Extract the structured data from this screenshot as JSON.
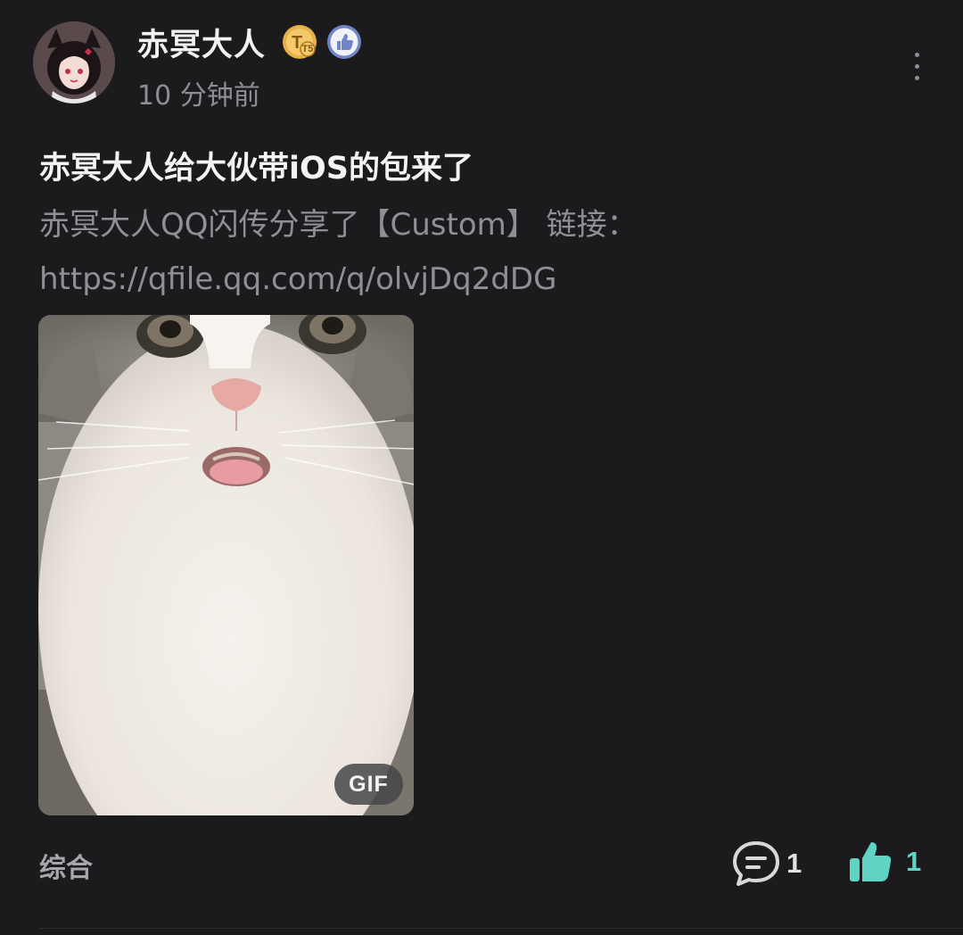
{
  "author": {
    "name": "赤冥大人",
    "level_badge": "T5",
    "level_icon": "level-t5-badge-icon",
    "like_badge_icon": "thumbs-up-badge-icon",
    "time": "10 分钟前"
  },
  "post": {
    "title": "赤冥大人给大伙带iOS的包来了",
    "body": "赤冥大人QQ闪传分享了【Custom】 链接：https://qfile.qq.com/q/olvjDq2dDG",
    "image_badge": "GIF",
    "image_subject": "cat-face-gif"
  },
  "footer": {
    "category": "综合",
    "comment_count": "1",
    "like_count": "1"
  },
  "colors": {
    "background": "#1b1b1d",
    "accent_like": "#5fd3c4",
    "muted_text": "#8f8f94",
    "badge_gold": "#e7b04a",
    "badge_blue": "#6f84c9"
  }
}
